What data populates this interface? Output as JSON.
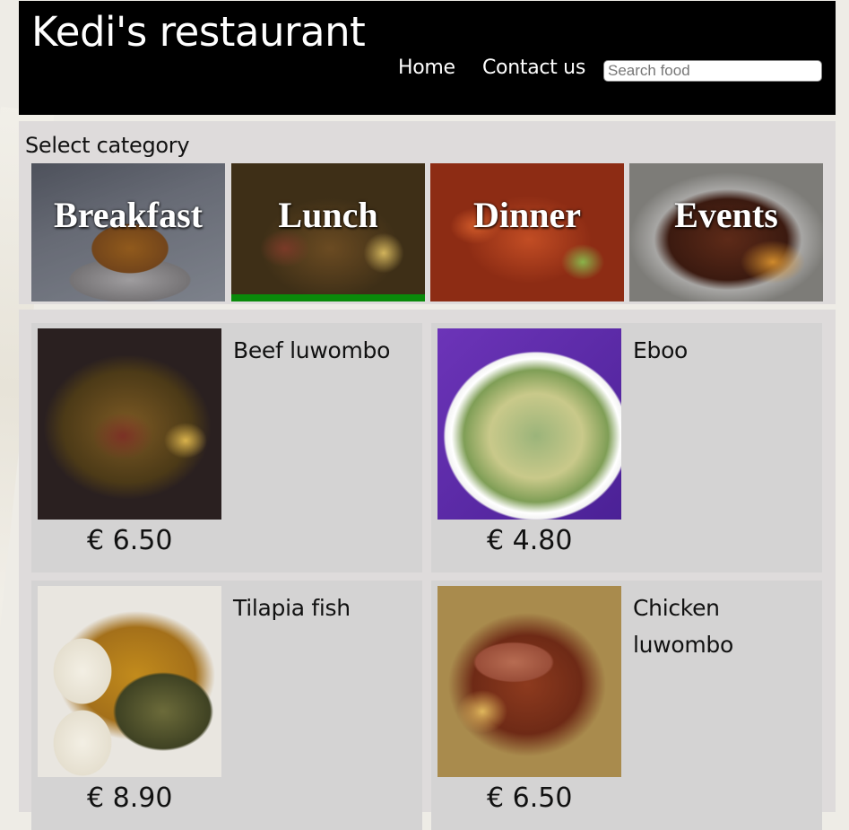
{
  "header": {
    "title": "Kedi's restaurant",
    "nav": [
      {
        "label": "Home"
      },
      {
        "label": "Contact us"
      }
    ],
    "search": {
      "placeholder": "Search food",
      "value": ""
    }
  },
  "categories": {
    "title": "Select category",
    "active": "Lunch",
    "items": [
      {
        "label": "Breakfast"
      },
      {
        "label": "Lunch"
      },
      {
        "label": "Dinner"
      },
      {
        "label": "Events"
      }
    ],
    "active_color": "#0a8a0a"
  },
  "menu": {
    "items": [
      {
        "name": "Beef luwombo",
        "price": "€ 6.50"
      },
      {
        "name": "Eboo",
        "price": "€ 4.80"
      },
      {
        "name": "Tilapia fish",
        "price": "€ 8.90"
      },
      {
        "name": "Chicken luwombo",
        "price": "€ 6.50"
      }
    ]
  }
}
